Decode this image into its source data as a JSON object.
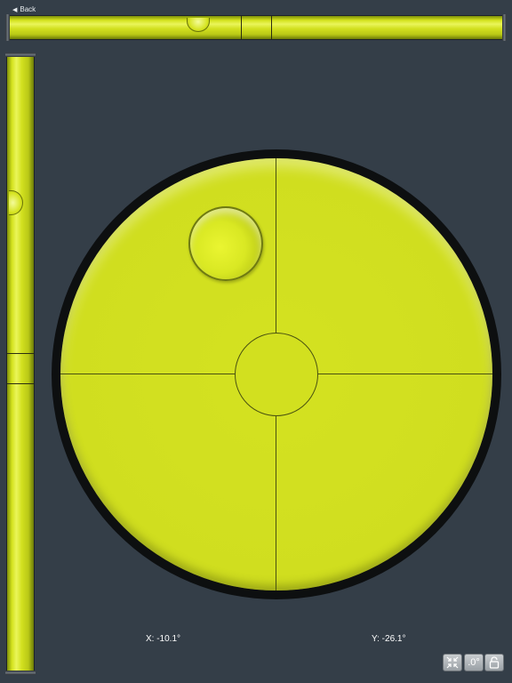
{
  "nav": {
    "back_label": "Back",
    "back_icon": "triangle-left-icon"
  },
  "readouts": {
    "x": "X: -10.1°",
    "y": "Y: -26.1°"
  },
  "toolbar": {
    "calibrate_icon": "compress-arrows-icon",
    "precision_label": ".0°",
    "lock_icon": "unlock-icon"
  },
  "colors": {
    "background": "#343e48",
    "level_liquid": "#d2e01f",
    "frame": "#0d0f10"
  }
}
